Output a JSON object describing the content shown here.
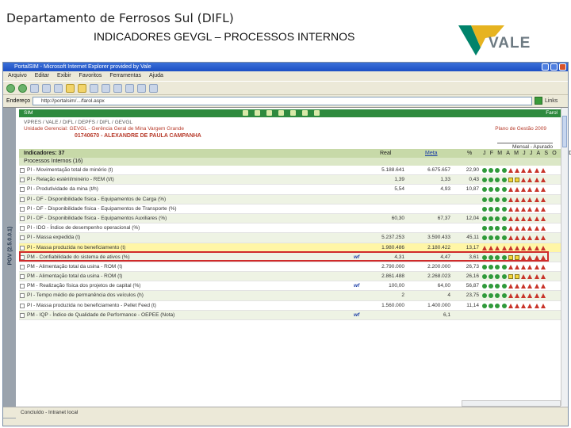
{
  "slide": {
    "title": "Departamento de Ferrosos Sul (DIFL)",
    "subtitle": "INDICADORES GEVGL – PROCESSOS INTERNOS",
    "logo_text": "VALE"
  },
  "browser": {
    "title": "PortalSIM - Microsoft Internet Explorer provided by Vale",
    "menu": [
      "Arquivo",
      "Editar",
      "Exibir",
      "Favoritos",
      "Ferramentas",
      "Ajuda"
    ],
    "address_label": "Endereço",
    "address": "http://portalsim/.../farol.aspx",
    "go_label": "Links",
    "status": "Concluído - Intranet local"
  },
  "app": {
    "system": "SIM",
    "farol": "Farol",
    "breadcrumb": "VPRES / VALE / DIFL / DEPFS / DIFL / GEVGL",
    "unit": "Unidade Gerencial: GEVGL - Gerência Geral de Mina Vargem Grande",
    "plan": "Plano de Gestão 2009",
    "responsible": "01740670 - ALEXANDRE DE PAULA CAMPANHA",
    "period": "Mensal - Apurado",
    "vertical_label": "PGV (2.5.0.0.1)",
    "indicators_label": "Indicadores: 37",
    "col_real": "Real",
    "col_meta": "Meta",
    "col_pct": "%",
    "months": [
      "J",
      "F",
      "M",
      "A",
      "M",
      "J",
      "J",
      "A",
      "S",
      "O",
      "N",
      "D"
    ],
    "processes": "Processos Internos (16)"
  },
  "rows": [
    {
      "name": "PI - Movimentação total de minério (t)",
      "real": "5.188.641",
      "meta": "6.675.657",
      "pct": "22,90",
      "signals": [
        "g",
        "g",
        "g",
        "g",
        "r",
        "r",
        "r",
        "r",
        "r",
        "r"
      ]
    },
    {
      "name": "PI - Relação estéril/minério - REM (t/t)",
      "real": "1,39",
      "meta": "1,33",
      "pct": "0,43",
      "signals": [
        "g",
        "g",
        "g",
        "g",
        "y",
        "y",
        "r",
        "r",
        "r",
        "r"
      ]
    },
    {
      "name": "PI - Produtividade da mina (t/h)",
      "real": "5,54",
      "meta": "4,93",
      "pct": "10,87",
      "signals": [
        "g",
        "g",
        "g",
        "g",
        "r",
        "r",
        "r",
        "r",
        "r",
        "r"
      ]
    },
    {
      "name": "PI - DF - Disponibilidade física - Equipamentos de Carga (%)",
      "real": "",
      "meta": "",
      "pct": "",
      "signals": [
        "g",
        "g",
        "g",
        "g",
        "r",
        "r",
        "r",
        "r",
        "r",
        "r"
      ]
    },
    {
      "name": "PI - DF - Disponibilidade física - Equipamentos de Transporte (%)",
      "real": "",
      "meta": "",
      "pct": "",
      "signals": [
        "g",
        "g",
        "g",
        "g",
        "r",
        "r",
        "r",
        "r",
        "r",
        "r"
      ]
    },
    {
      "name": "PI - DF - Disponibilidade física - Equipamentos Auxiliares (%)",
      "real": "60,30",
      "meta": "67,37",
      "pct": "12,04",
      "signals": [
        "g",
        "g",
        "g",
        "g",
        "r",
        "r",
        "r",
        "r",
        "r",
        "r"
      ]
    },
    {
      "name": "PI - IDO - Índice de desempenho operacional (%)",
      "real": "",
      "meta": "",
      "pct": "",
      "signals": [
        "g",
        "g",
        "g",
        "g",
        "r",
        "r",
        "r",
        "r",
        "r",
        "r"
      ]
    },
    {
      "name": "PI - Massa expedida (t)",
      "real": "5.237.253",
      "meta": "3.590.433",
      "pct": "45,11",
      "signals": [
        "g",
        "g",
        "g",
        "g",
        "r",
        "r",
        "r",
        "r",
        "r",
        "r"
      ]
    },
    {
      "name": "PI - Massa produzida no beneficiamento (t)",
      "real": "1.980.486",
      "meta": "2.180.422",
      "pct": "13,17",
      "signals": [
        "r",
        "r",
        "r",
        "r",
        "r",
        "r",
        "r",
        "r",
        "r",
        "r"
      ],
      "highlight": true
    },
    {
      "name": "PM - Confiabilidade do sistema de ativos (%)",
      "real": "4,31",
      "meta": "4,47",
      "pct": "3,61",
      "signals": [
        "g",
        "g",
        "g",
        "g",
        "y",
        "y",
        "r",
        "r",
        "r",
        "r"
      ],
      "note": "wf"
    },
    {
      "name": "PM - Alimentação total da usina - ROM (t)",
      "real": "2.790.000",
      "meta": "2.200.000",
      "pct": "26,73",
      "signals": [
        "g",
        "g",
        "g",
        "g",
        "r",
        "r",
        "r",
        "r",
        "r",
        "r"
      ]
    },
    {
      "name": "PM - Alimentação total da usina - ROM (t)",
      "real": "2.861.488",
      "meta": "2.268.023",
      "pct": "26,16",
      "signals": [
        "g",
        "g",
        "g",
        "g",
        "y",
        "y",
        "r",
        "r",
        "r",
        "r"
      ]
    },
    {
      "name": "PM - Realização física dos projetos de capital (%)",
      "real": "100,00",
      "meta": "64,00",
      "pct": "56,87",
      "signals": [
        "g",
        "g",
        "g",
        "g",
        "r",
        "r",
        "r",
        "r",
        "r",
        "r"
      ],
      "note": "wf"
    },
    {
      "name": "PI - Tempo médio de permanência dos veículos (h)",
      "real": "2",
      "meta": "4",
      "pct": "23,75",
      "signals": [
        "g",
        "g",
        "g",
        "g",
        "r",
        "r",
        "r",
        "r",
        "r",
        "r"
      ]
    },
    {
      "name": "PI - Massa produzida no beneficiamento - Pellet Feed (t)",
      "real": "1.560.000",
      "meta": "1.400.000",
      "pct": "11,14",
      "signals": [
        "g",
        "g",
        "g",
        "g",
        "r",
        "r",
        "r",
        "r",
        "r",
        "r"
      ]
    },
    {
      "name": "PM - IQP - Índice de Qualidade de Performance - OEPEE (Nota)",
      "real": "",
      "meta": "6,1",
      "pct": "",
      "signals": [],
      "note": "wf"
    }
  ]
}
